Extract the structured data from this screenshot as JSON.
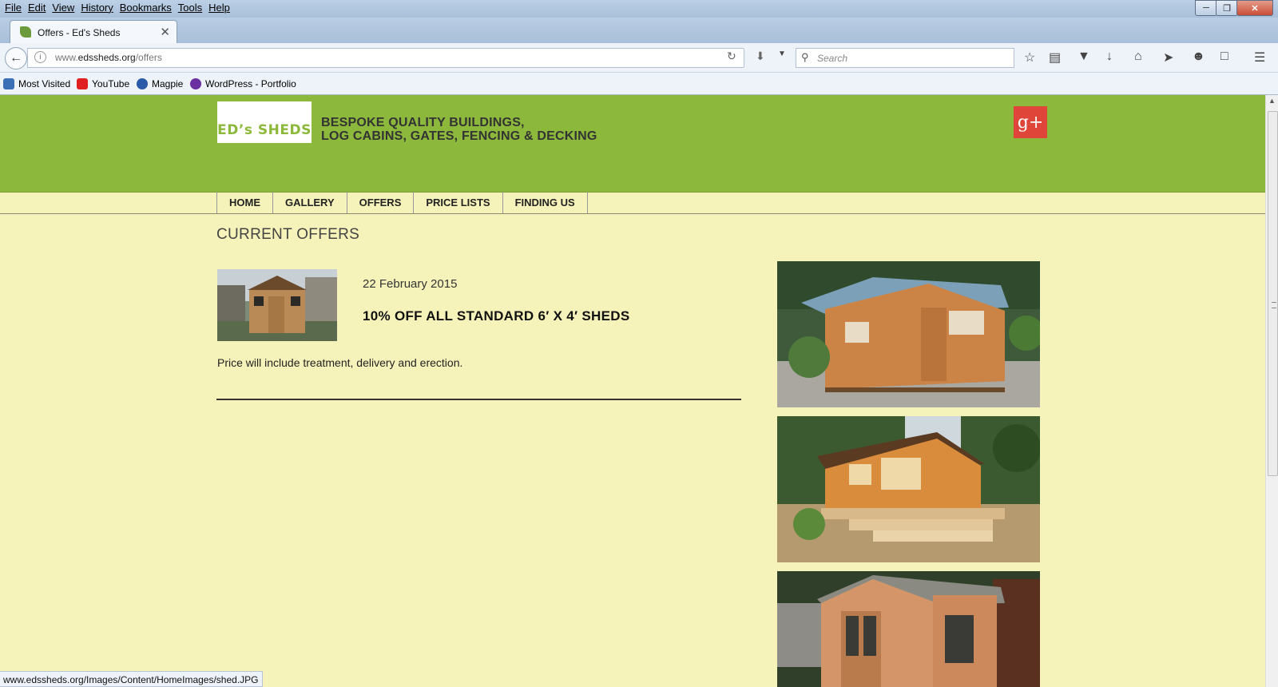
{
  "browser": {
    "menu": [
      "File",
      "Edit",
      "View",
      "History",
      "Bookmarks",
      "Tools",
      "Help"
    ],
    "tab_title": "Offers - Ed's Sheds",
    "url_domain_prefix": "www.",
    "url_domain": "edssheds.org",
    "url_path": "/offers",
    "search_placeholder": "Search",
    "bookmarks": [
      {
        "label": "Most Visited",
        "color": "#3b6fb6"
      },
      {
        "label": "YouTube",
        "color": "#e02020"
      },
      {
        "label": "Magpie",
        "color": "#2a5aa8"
      },
      {
        "label": "WordPress - Portfolio",
        "color": "#6a2fa0"
      }
    ],
    "status_url": "www.edssheds.org/Images/Content/HomeImages/shed.JPG"
  },
  "site": {
    "logo_text": "ED’s SHEDS",
    "tagline_line1": "BESPOKE QUALITY BUILDINGS,",
    "tagline_line2": "LOG CABINS, GATES, FENCING & DECKING",
    "social_label": "g+",
    "nav": [
      "HOME",
      "GALLERY",
      "OFFERS",
      "PRICE LISTS",
      "FINDING US"
    ],
    "colors": {
      "header_green": "#8cb83b",
      "page_bg": "#f5f3b9",
      "google_red": "#e0453a"
    }
  },
  "main": {
    "title": "CURRENT OFFERS",
    "offer": {
      "date": "22 February 2015",
      "headline": "10% OFF ALL STANDARD 6′ X 4′ SHEDS",
      "description": "Price will include treatment, delivery and erection."
    }
  }
}
